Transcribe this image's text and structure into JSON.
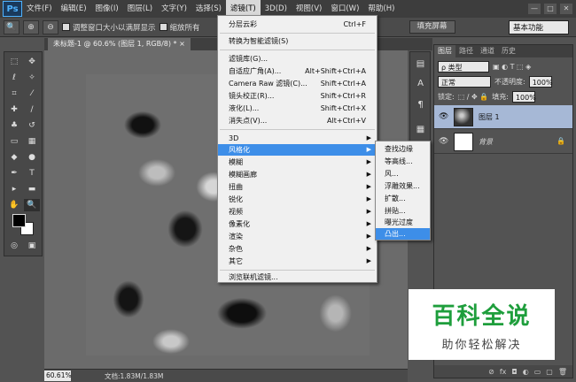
{
  "menubar": {
    "logo": "Ps",
    "items": [
      "文件(F)",
      "编辑(E)",
      "图像(I)",
      "图层(L)",
      "文字(Y)",
      "选择(S)",
      "滤镜(T)",
      "3D(D)",
      "视图(V)",
      "窗口(W)",
      "帮助(H)"
    ],
    "window_controls": [
      "—",
      "□",
      "✕"
    ]
  },
  "options": {
    "check1": "调整窗口大小以满屏显示",
    "check2": "缩放所有",
    "fill_screen": "填充屏幕",
    "workspace": "基本功能"
  },
  "document": {
    "tab_label": "未标题-1 @ 60.6% (图层 1, RGB/8) * ×",
    "zoom": "60.61%",
    "doc_info": "文档:1.83M/1.83M"
  },
  "filter_menu": {
    "items": [
      {
        "label": "分层云彩",
        "shortcut": "Ctrl+F"
      },
      {
        "label": "转换为智能滤镜(S)",
        "shortcut": ""
      },
      {
        "label": "滤镜库(G)...",
        "shortcut": ""
      },
      {
        "label": "自适应广角(A)...",
        "shortcut": "Alt+Shift+Ctrl+A"
      },
      {
        "label": "Camera Raw 滤镜(C)...",
        "shortcut": "Shift+Ctrl+A"
      },
      {
        "label": "镜头校正(R)...",
        "shortcut": "Shift+Ctrl+R"
      },
      {
        "label": "液化(L)...",
        "shortcut": "Shift+Ctrl+X"
      },
      {
        "label": "消失点(V)...",
        "shortcut": "Alt+Ctrl+V"
      },
      {
        "label": "3D",
        "shortcut": ""
      },
      {
        "label": "风格化",
        "shortcut": ""
      },
      {
        "label": "模糊",
        "shortcut": ""
      },
      {
        "label": "模糊画廊",
        "shortcut": ""
      },
      {
        "label": "扭曲",
        "shortcut": ""
      },
      {
        "label": "锐化",
        "shortcut": ""
      },
      {
        "label": "视频",
        "shortcut": ""
      },
      {
        "label": "像素化",
        "shortcut": ""
      },
      {
        "label": "渲染",
        "shortcut": ""
      },
      {
        "label": "杂色",
        "shortcut": ""
      },
      {
        "label": "其它",
        "shortcut": ""
      },
      {
        "label": "浏览联机滤镜...",
        "shortcut": ""
      }
    ]
  },
  "stylize_menu": {
    "items": [
      "查找边缘",
      "等高线...",
      "风...",
      "浮雕效果...",
      "扩散...",
      "拼贴...",
      "曝光过度",
      "凸出..."
    ]
  },
  "layers_panel": {
    "tabs": [
      "图层",
      "路径",
      "通道",
      "历史"
    ],
    "filter_kind": "ρ 类型",
    "blend_mode": "正常",
    "opacity_label": "不透明度:",
    "opacity_value": "100%",
    "lock_label": "锁定:",
    "fill_label": "填充:",
    "fill_value": "100%",
    "layers": [
      {
        "name": "图层 1",
        "selected": true
      },
      {
        "name": "背景",
        "selected": false
      }
    ]
  },
  "watermark": {
    "title": "百科全说",
    "subtitle": "助你轻松解决"
  }
}
